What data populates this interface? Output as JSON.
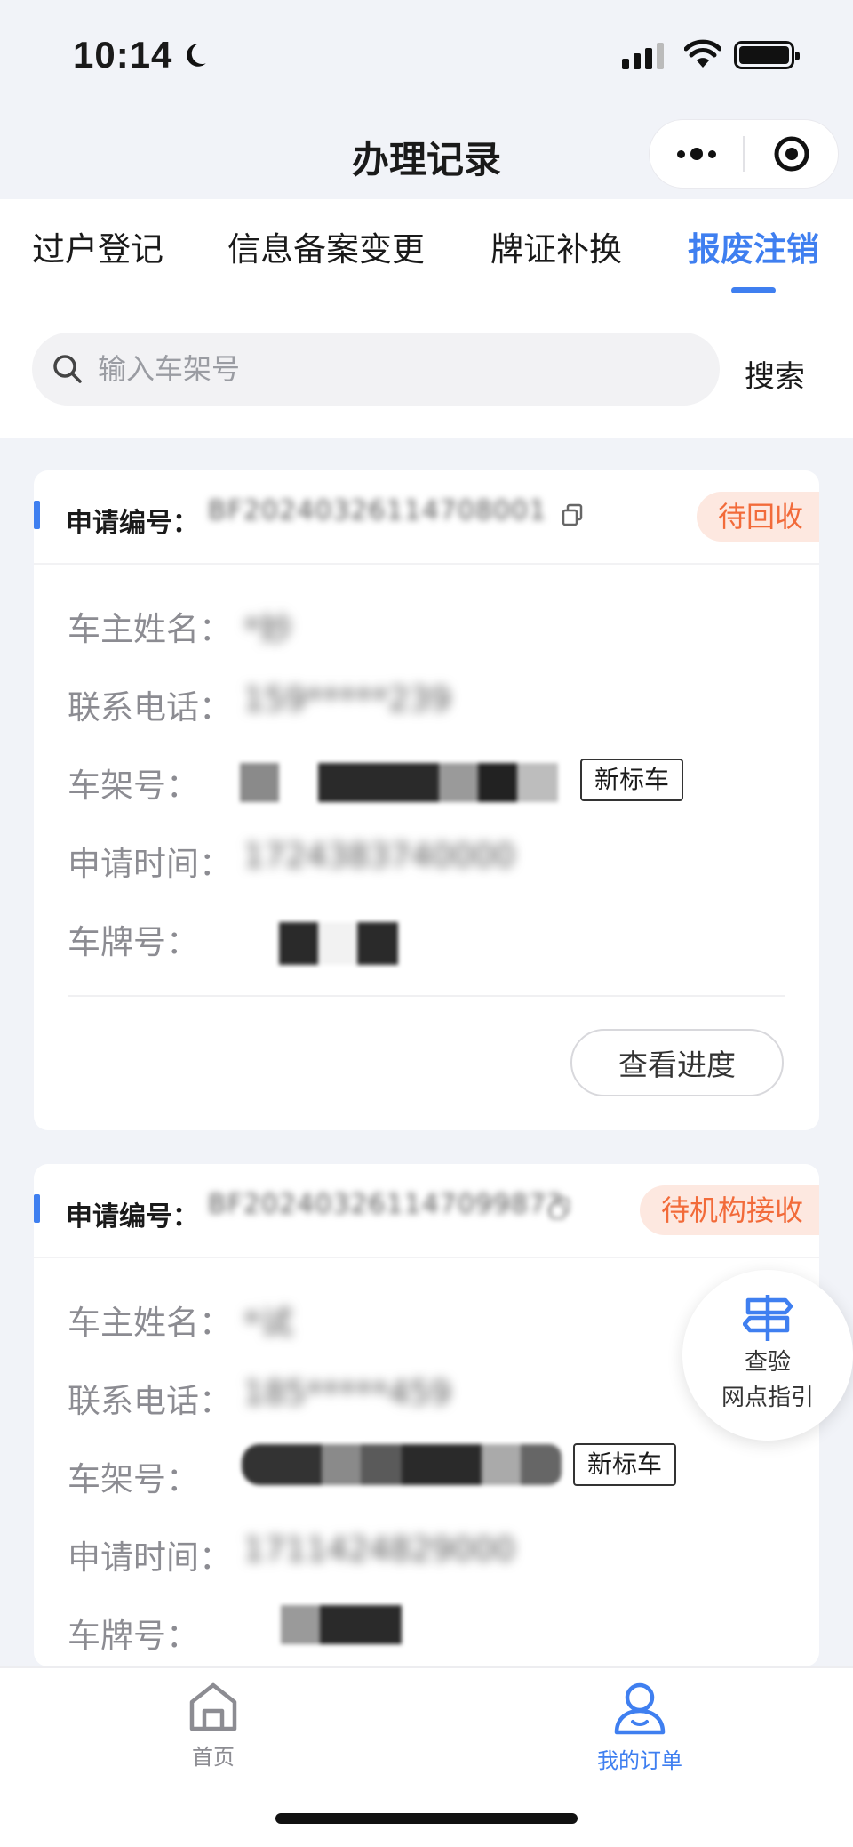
{
  "status_bar": {
    "time": "10:14"
  },
  "nav": {
    "title": "办理记录"
  },
  "tabs": [
    {
      "label": "过户登记"
    },
    {
      "label": "信息备案变更"
    },
    {
      "label": "牌证补换"
    },
    {
      "label": "报废注销"
    }
  ],
  "search": {
    "placeholder": "输入车架号",
    "button_label": "搜索"
  },
  "labels": {
    "app_no": "申请编号：",
    "owner_name": "车主姓名：",
    "phone": "联系电话：",
    "vin": "车架号：",
    "apply_time": "申请时间：",
    "plate": "车牌号："
  },
  "records": [
    {
      "app_no": "BF20240326114708001",
      "status": "待回收",
      "owner_name": "*妙",
      "phone": "159*****239",
      "apply_time": "1724383740000",
      "tag": "新标车",
      "action_label": "查看进度"
    },
    {
      "app_no": "BF202403261147099872",
      "status": "待机构接收",
      "owner_name": "*试",
      "phone": "185*****459",
      "apply_time": "1711424829000",
      "tag": "新标车"
    }
  ],
  "float_guide": {
    "line1": "查验",
    "line2": "网点指引"
  },
  "tabbar": [
    {
      "label": "首页",
      "icon": "home-icon"
    },
    {
      "label": "我的订单",
      "icon": "user-icon"
    }
  ],
  "colors": {
    "accent": "#3f7ff0",
    "status_text": "#f26b3a",
    "status_bg": "#fde8e0",
    "page_bg": "#f1f3f8"
  }
}
